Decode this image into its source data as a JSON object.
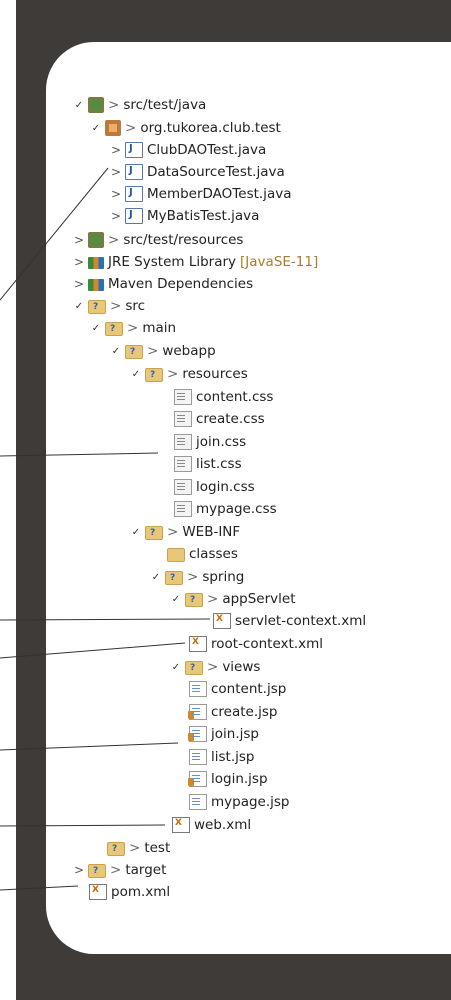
{
  "tree": [
    {
      "label": "src/test/java",
      "prefix": ">",
      "chevron": "open",
      "icon": "package-folder-icon"
    },
    {
      "label": "org.tukorea.club.test",
      "prefix": ">",
      "chevron": "open",
      "icon": "package-icon"
    },
    {
      "label": "ClubDAOTest.java",
      "prefix": "",
      "chevron": "closed",
      "icon": "java-file-icon"
    },
    {
      "label": "DataSourceTest.java",
      "prefix": "",
      "chevron": "closed",
      "icon": "java-file-icon"
    },
    {
      "label": "MemberDAOTest.java",
      "prefix": "",
      "chevron": "closed",
      "icon": "java-file-icon"
    },
    {
      "label": "MyBatisTest.java",
      "prefix": "",
      "chevron": "closed",
      "icon": "java-file-icon"
    },
    {
      "label": "src/test/resources",
      "prefix": ">",
      "chevron": "closed",
      "icon": "package-folder-icon"
    },
    {
      "label": "JRE System Library",
      "secondary": "[JavaSE-11]",
      "prefix": "",
      "chevron": "closed",
      "icon": "library-icon"
    },
    {
      "label": "Maven Dependencies",
      "prefix": "",
      "chevron": "closed",
      "icon": "library-icon"
    },
    {
      "label": "src",
      "prefix": ">",
      "chevron": "open",
      "icon": "folder-icon"
    },
    {
      "label": "main",
      "prefix": ">",
      "chevron": "open",
      "icon": "folder-icon"
    },
    {
      "label": "webapp",
      "prefix": ">",
      "chevron": "open",
      "icon": "folder-icon"
    },
    {
      "label": "resources",
      "prefix": ">",
      "chevron": "open",
      "icon": "folder-icon"
    },
    {
      "label": "content.css",
      "prefix": "",
      "chevron": "none",
      "icon": "css-file-icon"
    },
    {
      "label": "create.css",
      "prefix": "",
      "chevron": "none",
      "icon": "css-file-icon"
    },
    {
      "label": "join.css",
      "prefix": "",
      "chevron": "none",
      "icon": "css-file-icon"
    },
    {
      "label": "list.css",
      "prefix": "",
      "chevron": "none",
      "icon": "css-file-icon"
    },
    {
      "label": "login.css",
      "prefix": "",
      "chevron": "none",
      "icon": "css-file-icon"
    },
    {
      "label": "mypage.css",
      "prefix": "",
      "chevron": "none",
      "icon": "css-file-icon"
    },
    {
      "label": "WEB-INF",
      "prefix": ">",
      "chevron": "open",
      "icon": "folder-icon"
    },
    {
      "label": "classes",
      "prefix": "",
      "chevron": "none",
      "icon": "open-folder-icon"
    },
    {
      "label": "spring",
      "prefix": ">",
      "chevron": "open",
      "icon": "folder-icon"
    },
    {
      "label": "appServlet",
      "prefix": ">",
      "chevron": "open",
      "icon": "folder-icon"
    },
    {
      "label": "servlet-context.xml",
      "prefix": "",
      "chevron": "none",
      "icon": "xml-file-icon"
    },
    {
      "label": "root-context.xml",
      "prefix": "",
      "chevron": "none",
      "icon": "xml-file-icon"
    },
    {
      "label": "views",
      "prefix": ">",
      "chevron": "open",
      "icon": "folder-icon"
    },
    {
      "label": "content.jsp",
      "prefix": "",
      "chevron": "none",
      "icon": "jsp-file-icon"
    },
    {
      "label": "create.jsp",
      "prefix": "",
      "chevron": "none",
      "icon": "jsp-file-icon"
    },
    {
      "label": "join.jsp",
      "prefix": "",
      "chevron": "none",
      "icon": "jsp-file-icon"
    },
    {
      "label": "list.jsp",
      "prefix": "",
      "chevron": "none",
      "icon": "jsp-file-icon"
    },
    {
      "label": "login.jsp",
      "prefix": "",
      "chevron": "none",
      "icon": "jsp-file-icon"
    },
    {
      "label": "mypage.jsp",
      "prefix": "",
      "chevron": "none",
      "icon": "jsp-file-icon"
    },
    {
      "label": "web.xml",
      "prefix": "",
      "chevron": "none",
      "icon": "xml-file-icon"
    },
    {
      "label": "test",
      "prefix": ">",
      "chevron": "none",
      "icon": "folder-icon"
    },
    {
      "label": "target",
      "prefix": ">",
      "chevron": "closed",
      "icon": "folder-icon"
    },
    {
      "label": "pom.xml",
      "prefix": "",
      "chevron": "none",
      "icon": "maven-file-icon"
    }
  ]
}
